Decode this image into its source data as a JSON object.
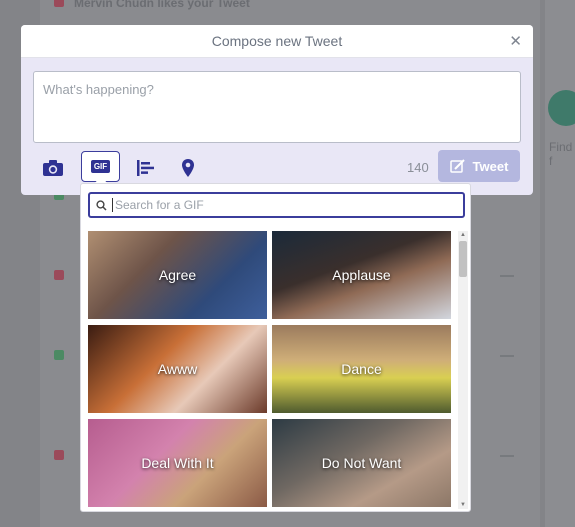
{
  "background": {
    "notification_text": "Mervin Chudn likes your Tweet",
    "right_link": "Find f"
  },
  "modal": {
    "title": "Compose new Tweet",
    "close_icon": "close-icon",
    "textarea_placeholder": "What's happening?",
    "toolbar": {
      "camera_icon": "camera-icon",
      "gif_label": "GIF",
      "poll_icon": "poll-icon",
      "location_icon": "location-pin-icon"
    },
    "char_count": "140",
    "tweet_label": "Tweet",
    "accent_color": "#2f3293"
  },
  "gif_picker": {
    "search_placeholder": "Search for a GIF",
    "categories": [
      {
        "label": "Agree"
      },
      {
        "label": "Applause"
      },
      {
        "label": "Awww"
      },
      {
        "label": "Dance"
      },
      {
        "label": "Deal With It"
      },
      {
        "label": "Do Not Want"
      }
    ]
  }
}
